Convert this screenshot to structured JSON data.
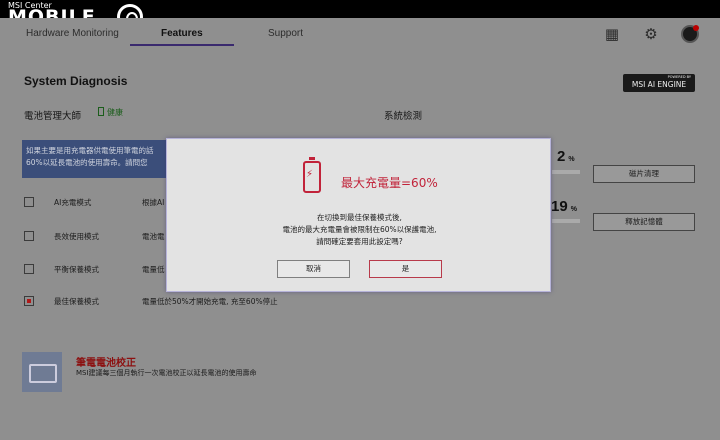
{
  "titlebar": {
    "app_name": "MSI Center",
    "brand": "MOBILE"
  },
  "tabs": [
    {
      "label": "Hardware Monitoring"
    },
    {
      "label": "Features"
    },
    {
      "label": "Support"
    }
  ],
  "header": {
    "icons": [
      "grid-icon",
      "gear-icon",
      "avatar"
    ]
  },
  "page": {
    "title": "System Diagnosis",
    "engine_badge": "MSI AI ENGINE",
    "engine_badge_small": "POWERED BY"
  },
  "battery_manager": {
    "title": "電池管理大師",
    "health_label": "健康",
    "info_line1": "如果主要是用充電器供電使用筆電的話",
    "info_line2": "60%以延長電池的使用壽命。請問您",
    "modes": [
      {
        "label": "AI充電模式",
        "desc": "根據AI",
        "checked": false
      },
      {
        "label": "長效使用模式",
        "desc": "電池電",
        "checked": false
      },
      {
        "label": "平衡保養模式",
        "desc": "電量低",
        "checked": false
      },
      {
        "label": "最佳保養模式",
        "desc": "電量低於50%才開始充電, 充至60%停止",
        "checked": true
      }
    ]
  },
  "system_check": {
    "title": "系統檢測",
    "stat1_value": "2",
    "stat1_unit": "%",
    "stat2_value": "19",
    "stat2_unit": "%",
    "button1": "磁片清理",
    "button2": "釋放記憶體"
  },
  "calibration": {
    "title": "筆電電池校正",
    "desc": "MSI建議每三個月執行一次電池校正以延長電池的使用壽命"
  },
  "modal": {
    "title": "最大充電量=60%",
    "line1": "在切換到最佳保養模式後,",
    "line2": "電池的最大充電量會被限制在60%以保護電池,",
    "line3": "請問確定要套用此設定嗎?",
    "cancel_label": "取消",
    "ok_label": "是",
    "accent_color": "#c1233a"
  }
}
